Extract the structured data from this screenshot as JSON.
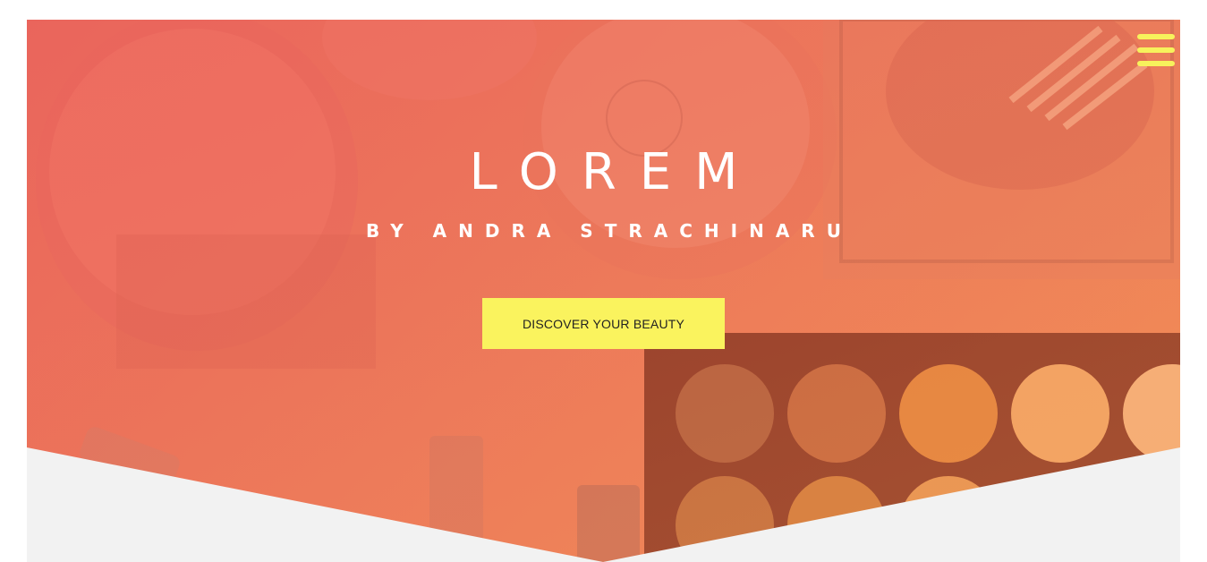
{
  "hero": {
    "title": "LOREM",
    "subtitle": "BY ANDRA STRACHINARU",
    "cta_label": "DISCOVER YOUR BEAUTY",
    "menu_icon": "hamburger-menu-icon"
  },
  "colors": {
    "accent_yellow": "#faf35e",
    "overlay_coral": "#ec7a5c",
    "footer_gray": "#f2f2f2",
    "text_white": "#ffffff"
  }
}
